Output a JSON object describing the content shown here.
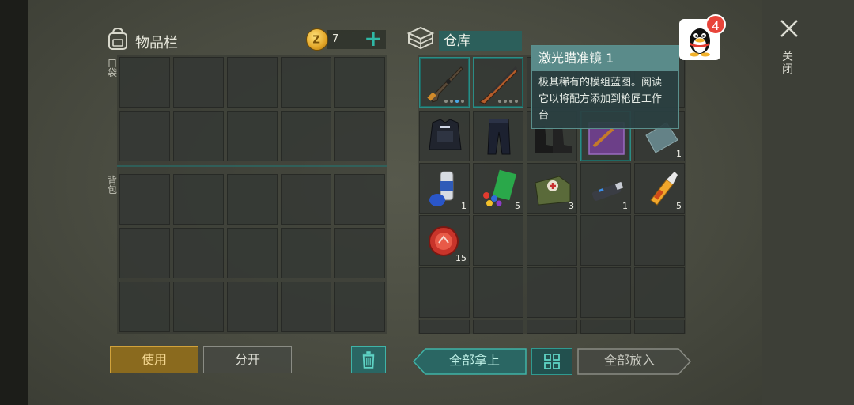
{
  "inventory": {
    "title": "物品栏",
    "pocket_label": "口袋",
    "backpack_label": "背包",
    "coins": "7",
    "add_label": "+"
  },
  "warehouse": {
    "title": "仓库",
    "items": [
      {
        "name": "rifle-icon",
        "qty": ""
      },
      {
        "name": "shotgun-icon",
        "qty": ""
      },
      {
        "name": "hidden",
        "qty": ""
      },
      {
        "name": "hidden",
        "qty": ""
      },
      {
        "name": "hidden",
        "qty": ""
      },
      {
        "name": "police-vest-icon",
        "qty": ""
      },
      {
        "name": "police-pants-icon",
        "qty": ""
      },
      {
        "name": "boots-icon",
        "qty": ""
      },
      {
        "name": "blueprint-icon",
        "qty": ""
      },
      {
        "name": "glass-shard-icon",
        "qty": "1"
      },
      {
        "name": "spray-paint-icon",
        "qty": "1"
      },
      {
        "name": "colored-plastic-icon",
        "qty": "5"
      },
      {
        "name": "medkit-bag-icon",
        "qty": "3"
      },
      {
        "name": "usb-drive-icon",
        "qty": "1"
      },
      {
        "name": "glue-icon",
        "qty": "5"
      },
      {
        "name": "bottle-cap-icon",
        "qty": "15"
      }
    ]
  },
  "tooltip": {
    "title": "激光瞄准镜 1",
    "line1": "极其稀有的模组蓝图。阅读",
    "line2": "它以将配方添加到枪匠工作",
    "line3": "台"
  },
  "buttons": {
    "use": "使用",
    "split": "分开",
    "take_all": "全部拿上",
    "put_all": "全部放入"
  },
  "notification": {
    "badge": "4"
  },
  "close": {
    "label": "关闭"
  },
  "colors": {
    "accent_teal": "#2fb7a5",
    "use_gold": "#d1a23b",
    "badge_red": "#e8443a"
  }
}
